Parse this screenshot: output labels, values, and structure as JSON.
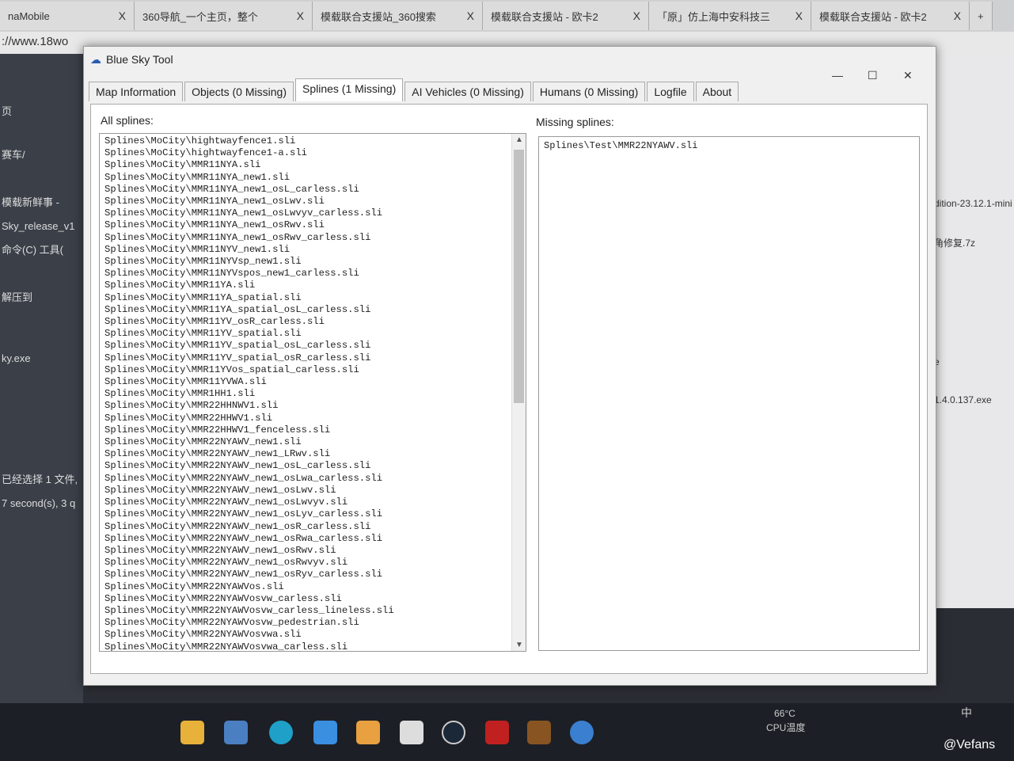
{
  "browser": {
    "tabs": [
      {
        "label": "naMobile"
      },
      {
        "label": "360导航_一个主页，整个"
      },
      {
        "label": "模载联合支援站_360搜索"
      },
      {
        "label": "模载联合支援站 - 欧卡2"
      },
      {
        "label": "「原」仿上海中安科技三"
      },
      {
        "label": "模载联合支援站 - 欧卡2"
      }
    ],
    "close": "X",
    "new_tab": "+",
    "address": "://www.18wo"
  },
  "desktop": {
    "left": [
      "页",
      "赛车/",
      "模载新鲜事 -",
      "Sky_release_v1",
      "命令(C)  工具(",
      "解压到",
      "ky.exe",
      "已经选择 1 文件,",
      "7 second(s), 3 q"
    ],
    "right": [
      "dition-23.12.1-mini",
      "角修复.7z",
      "e",
      "1.4.0.137.exe"
    ]
  },
  "window": {
    "title": "Blue Sky Tool",
    "minimize": "—",
    "maximize": "☐",
    "close": "✕",
    "tabs": [
      {
        "label": "Map Information"
      },
      {
        "label": "Objects (0 Missing)"
      },
      {
        "label": "Splines (1 Missing)"
      },
      {
        "label": "AI Vehicles (0 Missing)"
      },
      {
        "label": "Humans (0 Missing)"
      },
      {
        "label": "Logfile"
      },
      {
        "label": "About"
      }
    ],
    "all_label": "All splines:",
    "missing_label": "Missing splines:",
    "all_splines": [
      "Splines\\MoCity\\hightwayfence1.sli",
      "Splines\\MoCity\\hightwayfence1-a.sli",
      "Splines\\MoCity\\MMR11NYA.sli",
      "Splines\\MoCity\\MMR11NYA_new1.sli",
      "Splines\\MoCity\\MMR11NYA_new1_osL_carless.sli",
      "Splines\\MoCity\\MMR11NYA_new1_osLwv.sli",
      "Splines\\MoCity\\MMR11NYA_new1_osLwvyv_carless.sli",
      "Splines\\MoCity\\MMR11NYA_new1_osRwv.sli",
      "Splines\\MoCity\\MMR11NYA_new1_osRwv_carless.sli",
      "Splines\\MoCity\\MMR11NYV_new1.sli",
      "Splines\\MoCity\\MMR11NYVsp_new1.sli",
      "Splines\\MoCity\\MMR11NYVspos_new1_carless.sli",
      "Splines\\MoCity\\MMR11YA.sli",
      "Splines\\MoCity\\MMR11YA_spatial.sli",
      "Splines\\MoCity\\MMR11YA_spatial_osL_carless.sli",
      "Splines\\MoCity\\MMR11YV_osR_carless.sli",
      "Splines\\MoCity\\MMR11YV_spatial.sli",
      "Splines\\MoCity\\MMR11YV_spatial_osL_carless.sli",
      "Splines\\MoCity\\MMR11YV_spatial_osR_carless.sli",
      "Splines\\MoCity\\MMR11YVos_spatial_carless.sli",
      "Splines\\MoCity\\MMR11YVWA.sli",
      "Splines\\MoCity\\MMR1HH1.sli",
      "Splines\\MoCity\\MMR22HHNWV1.sli",
      "Splines\\MoCity\\MMR22HHWV1.sli",
      "Splines\\MoCity\\MMR22HHWV1_fenceless.sli",
      "Splines\\MoCity\\MMR22NYAWV_new1.sli",
      "Splines\\MoCity\\MMR22NYAWV_new1_LRwv.sli",
      "Splines\\MoCity\\MMR22NYAWV_new1_osL_carless.sli",
      "Splines\\MoCity\\MMR22NYAWV_new1_osLwa_carless.sli",
      "Splines\\MoCity\\MMR22NYAWV_new1_osLwv.sli",
      "Splines\\MoCity\\MMR22NYAWV_new1_osLwvyv.sli",
      "Splines\\MoCity\\MMR22NYAWV_new1_osLyv_carless.sli",
      "Splines\\MoCity\\MMR22NYAWV_new1_osR_carless.sli",
      "Splines\\MoCity\\MMR22NYAWV_new1_osRwa_carless.sli",
      "Splines\\MoCity\\MMR22NYAWV_new1_osRwv.sli",
      "Splines\\MoCity\\MMR22NYAWV_new1_osRwvyv.sli",
      "Splines\\MoCity\\MMR22NYAWV_new1_osRyv_carless.sli",
      "Splines\\MoCity\\MMR22NYAWVos.sli",
      "Splines\\MoCity\\MMR22NYAWVosvw_carless.sli",
      "Splines\\MoCity\\MMR22NYAWVosvw_carless_lineless.sli",
      "Splines\\MoCity\\MMR22NYAWVosvw_pedestrian.sli",
      "Splines\\MoCity\\MMR22NYAWVosvwa.sli",
      "Splines\\MoCity\\MMR22NYAWVosvwa_carless.sli"
    ],
    "missing_splines": [
      "Splines\\Test\\MMR22NYAWV.sli"
    ]
  },
  "taskbar": {
    "temp": "66°C",
    "temp_label": "CPU温度",
    "ime": "中",
    "watermark": "@Vefans"
  }
}
